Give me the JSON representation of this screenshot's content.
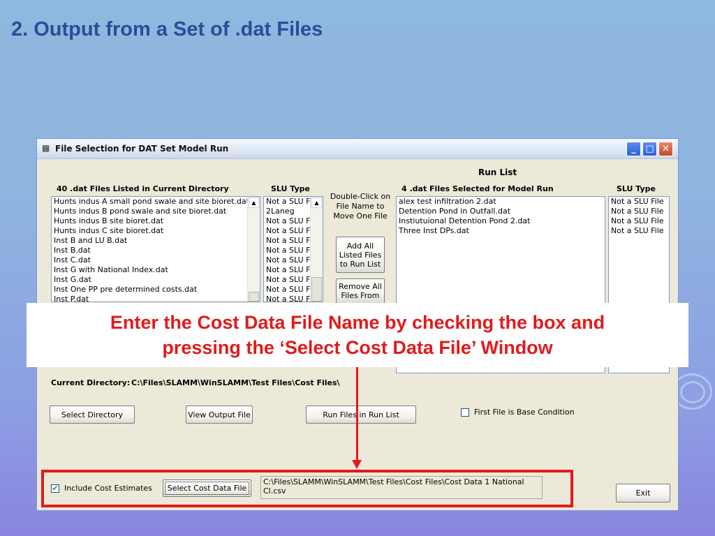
{
  "slide": {
    "title": "2.  Output from a Set of .dat Files",
    "callout_line1": "Enter the Cost Data File Name by checking the box and",
    "callout_line2": "pressing the ‘Select Cost Data File’ Window"
  },
  "window": {
    "title": "File Selection for DAT Set Model Run",
    "icon": "window-app-icon",
    "controls": {
      "minimize": "_",
      "maximize": "□",
      "close": "✕"
    }
  },
  "left_panel": {
    "header": "40 .dat Files Listed in Current Directory",
    "slu_header": "SLU Type",
    "files": [
      "Hunts indus A small pond swale and site bioret.dat",
      "Hunts indus B pond swale and site bioret.dat",
      "Hunts indus B site bioret.dat",
      "Hunts indus C site bioret.dat",
      "Inst B and LU B.dat",
      "Inst B.dat",
      "Inst C.dat",
      "Inst G with National Index.dat",
      "Inst G.dat",
      "Inst One PP pre determined costs.dat",
      "Inst P.dat"
    ],
    "slu_types": [
      "Not a SLU F",
      "2Laneg",
      "Not a SLU F",
      "Not a SLU F",
      "Not a SLU F",
      "Not a SLU F",
      "Not a SLU F",
      "Not a SLU F",
      "Not a SLU F",
      "Not a SLU F",
      "Not a SLU F"
    ]
  },
  "middle": {
    "instructions": "Double-Click on File Name to Move One File",
    "add_all_label": "Add All Listed Files to Run List",
    "remove_all_label": "Remove All Files From"
  },
  "run_list": {
    "title": "Run List",
    "header": "4 .dat Files Selected for Model Run",
    "slu_header": "SLU Type",
    "files": [
      "alex test infiltration 2.dat",
      "Detention Pond in Outfall.dat",
      "Instiutuional Detention Pond 2.dat",
      "Three Inst DPs.dat"
    ],
    "slu_types": [
      "Not a SLU File",
      "Not a SLU File",
      "Not a SLU File",
      "Not a SLU File"
    ]
  },
  "current_directory": {
    "label": "Current Directory:",
    "path": "C:\\Files\\SLAMM\\WinSLAMM\\Test Files\\Cost Files\\"
  },
  "buttons": {
    "select_directory": "Select Directory",
    "view_output": "View Output File",
    "run_files": "Run Files in Run List",
    "select_cost_file": "Select Cost Data File",
    "exit": "Exit"
  },
  "options": {
    "first_file_base": "First File is Base Condition",
    "include_cost": "Include Cost Estimates",
    "include_cost_checked": "✔"
  },
  "cost_file_path": "C:\\Files\\SLAMM\\WinSLAMM\\Test Files\\Cost Files\\Cost Data 1 National Cl.csv",
  "colors": {
    "title_blue": "#2a4d9a",
    "callout_red": "#e01b1b",
    "window_face": "#ece9d8"
  }
}
